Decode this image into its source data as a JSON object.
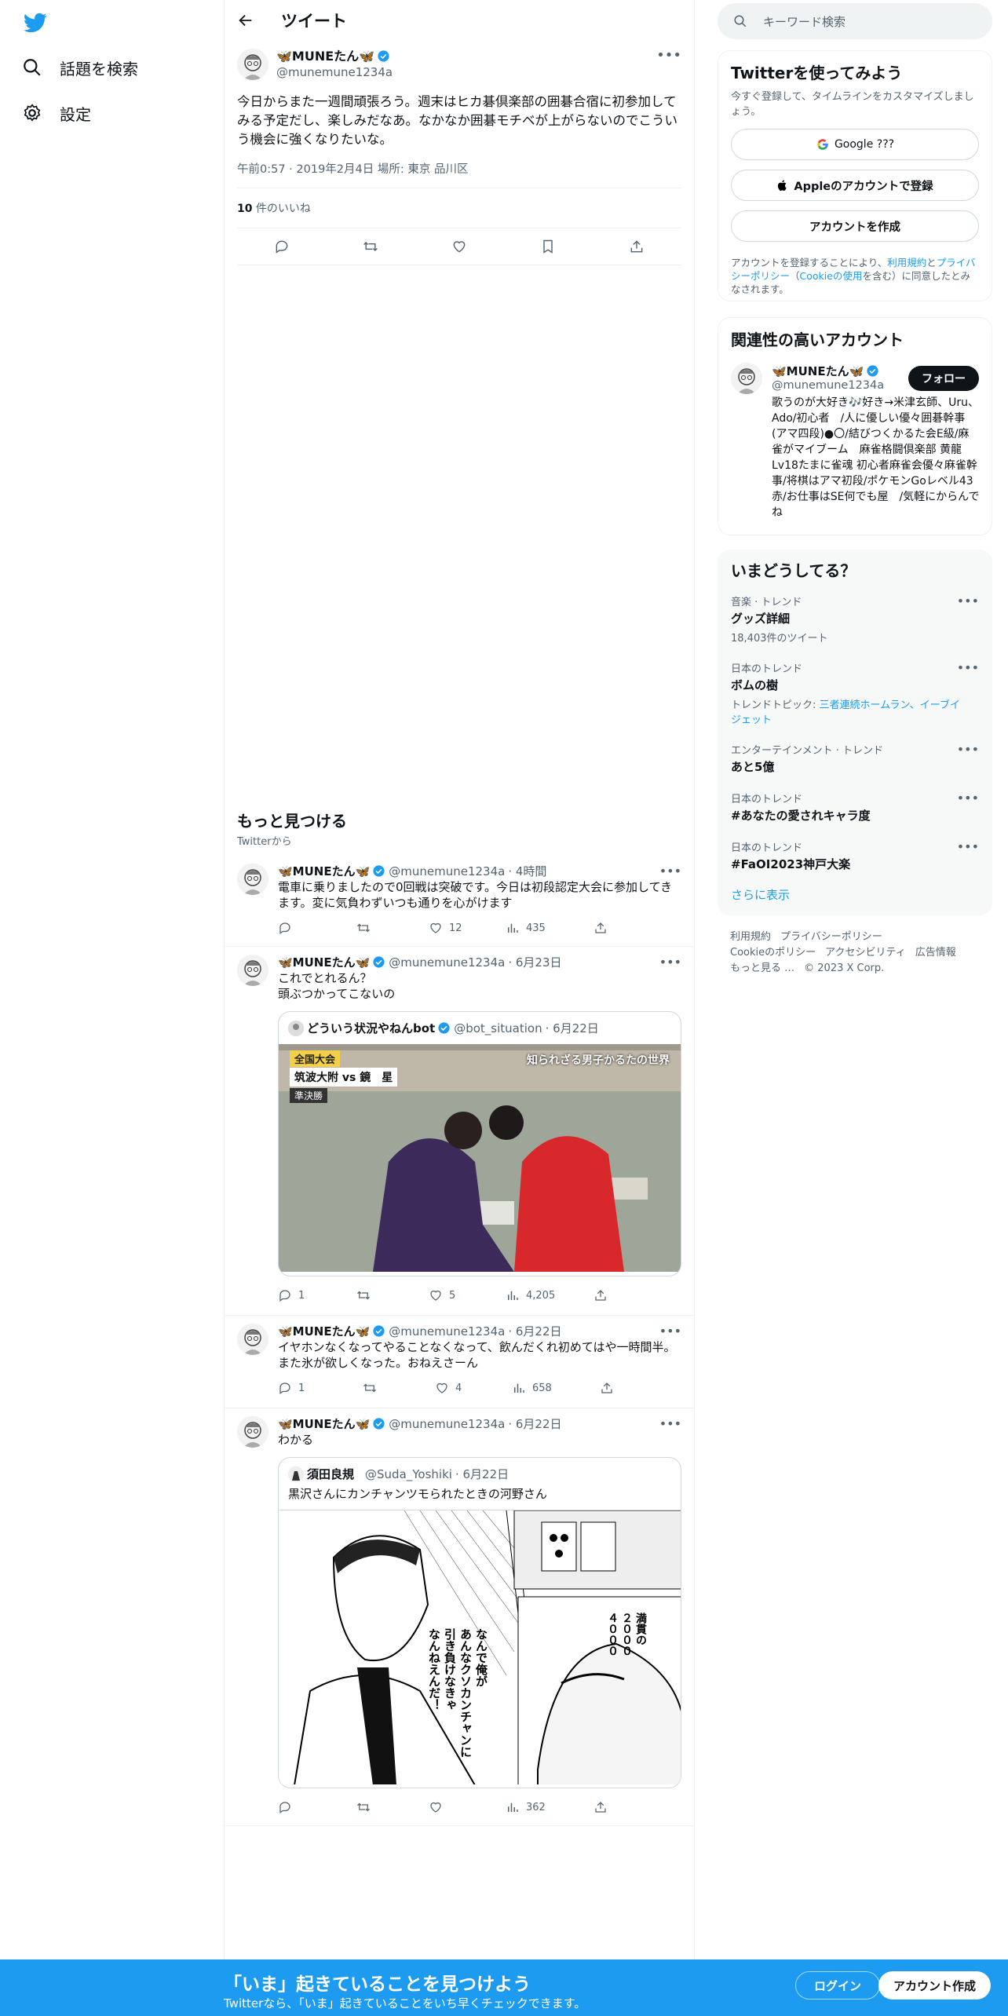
{
  "nav": {
    "explore_label": "話題を検索",
    "settings_label": "設定"
  },
  "header": {
    "title": "ツイート"
  },
  "focal_tweet": {
    "name": "🦋MUNEたん🦋",
    "handle": "@munemune1234a",
    "text": "今日からまた一週間頑張ろう。週末はヒカ碁倶楽部の囲碁合宿に初参加してみる予定だし、楽しみだなあ。なかなか囲碁モチベが上がらないのでこういう機会に強くなりたいな。",
    "meta": "午前0:57 · 2019年2月4日 場所: 東京 品川区",
    "likes_count": "10",
    "likes_label": " 件のいいね"
  },
  "more_section": {
    "title": "もっと見つける",
    "subtitle": "Twitterから"
  },
  "tweets": [
    {
      "name": "🦋MUNEたん🦋",
      "handle": "@munemune1234a",
      "time": "· 4時間",
      "text": "電車に乗りましたので0回戦は突破です。今日は初段認定大会に参加してきます。変に気負わずいつも通りを心がけます",
      "replies": "",
      "retweets": "",
      "likes": "12",
      "views": "435"
    },
    {
      "name": "🦋MUNEたん🦋",
      "handle": "@munemune1234a",
      "time": "· 6月23日",
      "text_line1": "これでとれるん？",
      "text_line2": "頭ぶつかってこないの",
      "quote": {
        "name": "どういう状況やねんbot",
        "handle": "@bot_situation",
        "time": "· 6月22日",
        "caption_tl": "全国大会",
        "caption_tl2": "筑波大附 vs 鏡　星",
        "caption_tl3": "準決勝",
        "caption_tr": "知られざる男子かるたの世界"
      },
      "replies": "1",
      "retweets": "",
      "likes": "5",
      "views": "4,205"
    },
    {
      "name": "🦋MUNEたん🦋",
      "handle": "@munemune1234a",
      "time": "· 6月22日",
      "text": "イヤホンなくなってやることなくなって、飲んだくれ初めてはや一時間半。また氷が欲しくなった。おねえさーん",
      "replies": "1",
      "retweets": "",
      "likes": "4",
      "views": "658"
    },
    {
      "name": "🦋MUNEたん🦋",
      "handle": "@munemune1234a",
      "time": "· 6月22日",
      "text": "わかる",
      "quote": {
        "name": "須田良規",
        "handle": "@Suda_Yoshiki",
        "time": "· 6月22日",
        "text": "黒沢さんにカンチャンツモられたときの河野さん",
        "manga_line1": "なんで俺が",
        "manga_line2": "あんなクソカンチャンに",
        "manga_line3": "引き負けなきゃ",
        "manga_line4": "なんねえんだ！",
        "manga_line5": "満貫の",
        "manga_line6": "２０００",
        "manga_line7": "４０００"
      },
      "replies": "",
      "retweets": "",
      "likes": "",
      "views": "362"
    }
  ],
  "right": {
    "search_placeholder": "キーワード検索",
    "signup_card": {
      "title": "Twitterを使ってみよう",
      "subtitle": "今すぐ登録して、タイムラインをカスタマイズしましょう。",
      "google_label": "Google ???",
      "apple_label": "Appleのアカウントで登録",
      "create_label": "アカウントを作成",
      "terms_1": "アカウントを登録することにより、",
      "terms_link1": "利用規約",
      "terms_2": "と",
      "terms_link2": "プライバシーポリシー",
      "terms_3": "（",
      "terms_link3": "Cookieの使用",
      "terms_4": "を含む）に同意したとみなされます。"
    },
    "related": {
      "title": "関連性の高いアカウント",
      "name": "🦋MUNEたん🦋",
      "handle": "@munemune1234a",
      "follow_label": "フォロー",
      "bio": "歌うのが大好き🎶好き→米津玄師、Uru、Ado/初心者　/人に優しい優々囲碁幹事(アマ四段)●〇/結びつくかるた会E級/麻雀がマイブーム　麻雀格闘倶楽部 黄龍Lv18たまに雀魂 初心者麻雀会優々麻雀幹事/将棋はアマ初段/ポケモンGoレベル43赤/お仕事はSE何でも屋　/気軽にからんでね"
    },
    "trends": {
      "title": "いまどうしてる？",
      "items": [
        {
          "category": "音楽 · トレンド",
          "name": "グッズ詳細",
          "count": "18,403件のツイート"
        },
        {
          "category": "日本のトレンド",
          "name": "ボムの樹",
          "count_prefix": "トレンドトピック: ",
          "count_links": "三者連続ホームラン、イーブイジェット"
        },
        {
          "category": "エンターテインメント · トレンド",
          "name": "あと5億"
        },
        {
          "category": "日本のトレンド",
          "name": "#あなたの愛されキャラ度"
        },
        {
          "category": "日本のトレンド",
          "name": "#FaOI2023神戸大楽"
        }
      ],
      "show_more": "さらに表示"
    },
    "footer": {
      "terms": "利用規約",
      "privacy": "プライバシーポリシー",
      "cookie": "Cookieのポリシー",
      "accessibility": "アクセシビリティ",
      "ads": "広告情報",
      "more": "もっと見る …",
      "copyright": "© 2023 X Corp."
    }
  },
  "bottom_bar": {
    "headline": "「いま」起きていることを見つけよう",
    "subtext": "Twitterなら、「いま」起きていることをいち早くチェックできます。",
    "login_label": "ログイン",
    "signup_label": "アカウント作成"
  },
  "colors": {
    "accent": "#1d9bf0",
    "text": "#0f1419",
    "muted": "#536471"
  }
}
